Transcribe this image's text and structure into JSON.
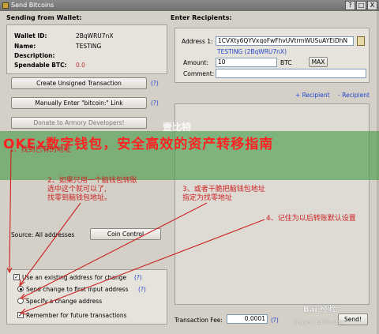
{
  "window": {
    "title": "Send Bitcoins",
    "buttons": [
      "?",
      "□",
      "X"
    ]
  },
  "left": {
    "title": "Sending from Wallet:",
    "wallet": {
      "id_label": "Wallet ID:",
      "id_value": "2BqWRU7nX",
      "name_label": "Name:",
      "name_value": "TESTING",
      "description_label": "Description:",
      "description_value": "",
      "spendable_label": "Spendable BTC:",
      "spendable_value": "0.0"
    },
    "buttons": {
      "create_unsigned": "Create Unsigned Transaction",
      "manual_link": "Manually Enter \"bitcoin:\" Link",
      "donate": "Donate to Armory Developers!"
    },
    "help_mark": "(?)",
    "source_label": "Source: All addresses",
    "coin_control": "Coin Control",
    "change": {
      "use_existing": "Use an existing address for change",
      "send_first_input": "Send change to first input address",
      "specify": "Specify a change address",
      "remember": "Remember for future transactions"
    }
  },
  "right": {
    "title": "Enter Recipients:",
    "address_label": "Address 1:",
    "address_value": "1CVXty6QYVxqoFwFhvUVtrmWUSuAYEiDhN",
    "address_owner": "TESTING (2BqWRU7nX)",
    "amount_label": "Amount:",
    "amount_value": "10",
    "amount_unit": "BTC",
    "max_label": "MAX",
    "comment_label": "Comment:",
    "comment_value": "",
    "add_recipient": "+ Recipient",
    "remove_recipient": "- Recipient",
    "fee_label": "Transaction Fee:",
    "fee_value": "0.0001",
    "send_label": "Send!"
  },
  "overlay": {
    "banner": "OKEx数字钱包，安全高效的资产转移指南",
    "watermark_top": "壹比特",
    "watermark_bottom": "jingyan.baidu.com",
    "watermark_logo": "Bai 经验",
    "note1": "1、找到已有的地址",
    "note2_line1": "2、如果只用一个脑钱包转账",
    "note2_line2": "选中这个就可以了,",
    "note2_line3": "找零到脑钱包地址。",
    "note3_line1": "3、或者干脆把脑钱包地址",
    "note3_line2": "指定为找零地址",
    "note4": "4、记住为以后转账默认设置"
  },
  "colors": {
    "annotation": "#cc2222",
    "banner": "#469b46",
    "link": "#2244cc"
  }
}
